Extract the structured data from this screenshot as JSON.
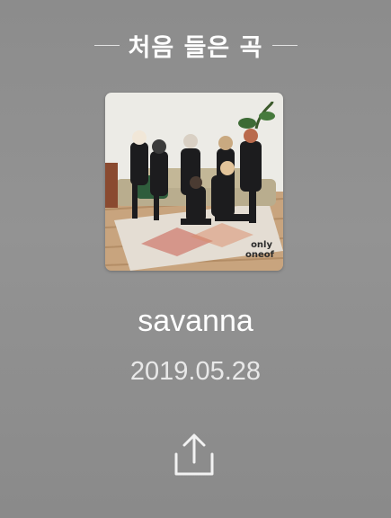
{
  "header": {
    "title": "처음 들은 곡"
  },
  "album": {
    "watermark_text": "only oneof"
  },
  "track": {
    "title": "savanna",
    "date": "2019.05.28"
  },
  "share": {
    "icon": "share-upload-icon"
  },
  "colors": {
    "background": "#8f8f8f",
    "text_primary": "#ffffff",
    "text_secondary": "#e8e8e8"
  }
}
